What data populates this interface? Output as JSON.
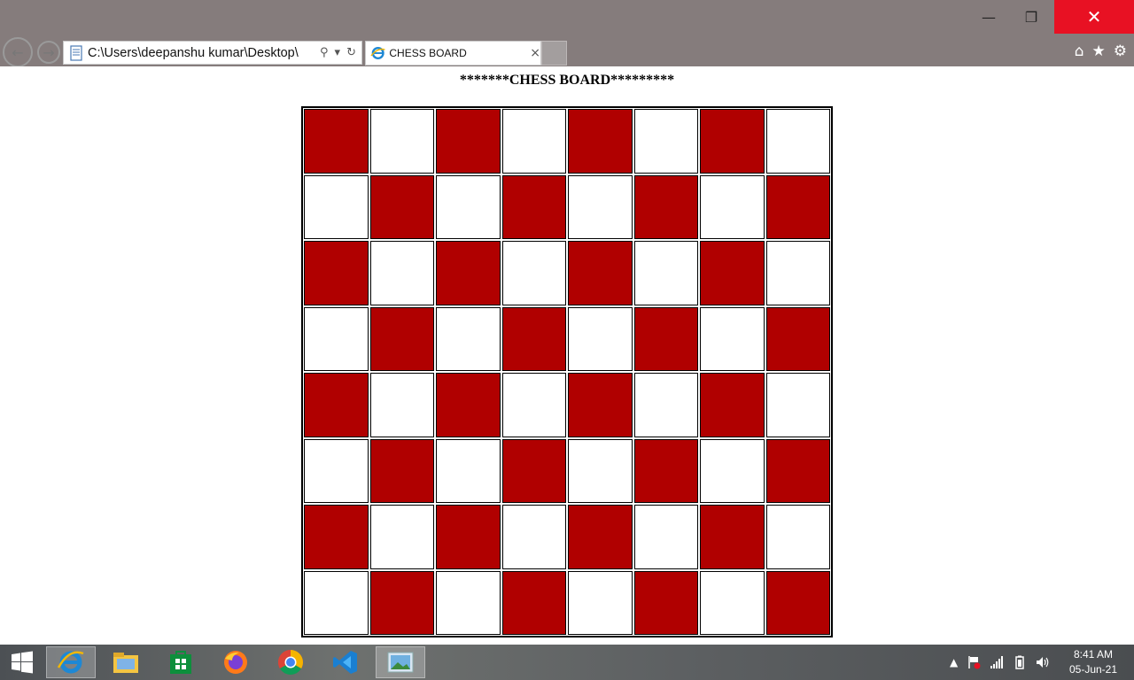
{
  "window": {
    "minimize_glyph": "—",
    "maximize_glyph": "❐",
    "close_glyph": "✕"
  },
  "toolbar": {
    "back_glyph": "←",
    "forward_glyph": "→",
    "address": "C:\\Users\\deepanshu kumar\\Desktop\\",
    "search_glyph": "⚲",
    "dropdown_glyph": "▾",
    "refresh_glyph": "↻",
    "home_glyph": "⌂",
    "favorites_glyph": "★",
    "settings_glyph": "⚙"
  },
  "tabs": [
    {
      "title": "CHESS BOARD",
      "close_glyph": "×"
    }
  ],
  "page": {
    "heading": "*******CHESS BOARD*********",
    "board": {
      "rows": 8,
      "cols": 8,
      "dark_color": "#b00000",
      "light_color": "#ffffff",
      "first_cell": "dark"
    }
  },
  "taskbar": {
    "apps": [
      "start-icon",
      "internet-explorer-icon",
      "file-explorer-icon",
      "store-icon",
      "firefox-icon",
      "chrome-icon",
      "vscode-icon",
      "photos-icon"
    ],
    "active_app": "internet-explorer-icon",
    "clock_time": "8:41 AM",
    "clock_date": "05-Jun-21"
  },
  "colors": {
    "titlebar": "#857c7c",
    "close_button": "#e81123",
    "ie_blue": "#1e88d4"
  }
}
